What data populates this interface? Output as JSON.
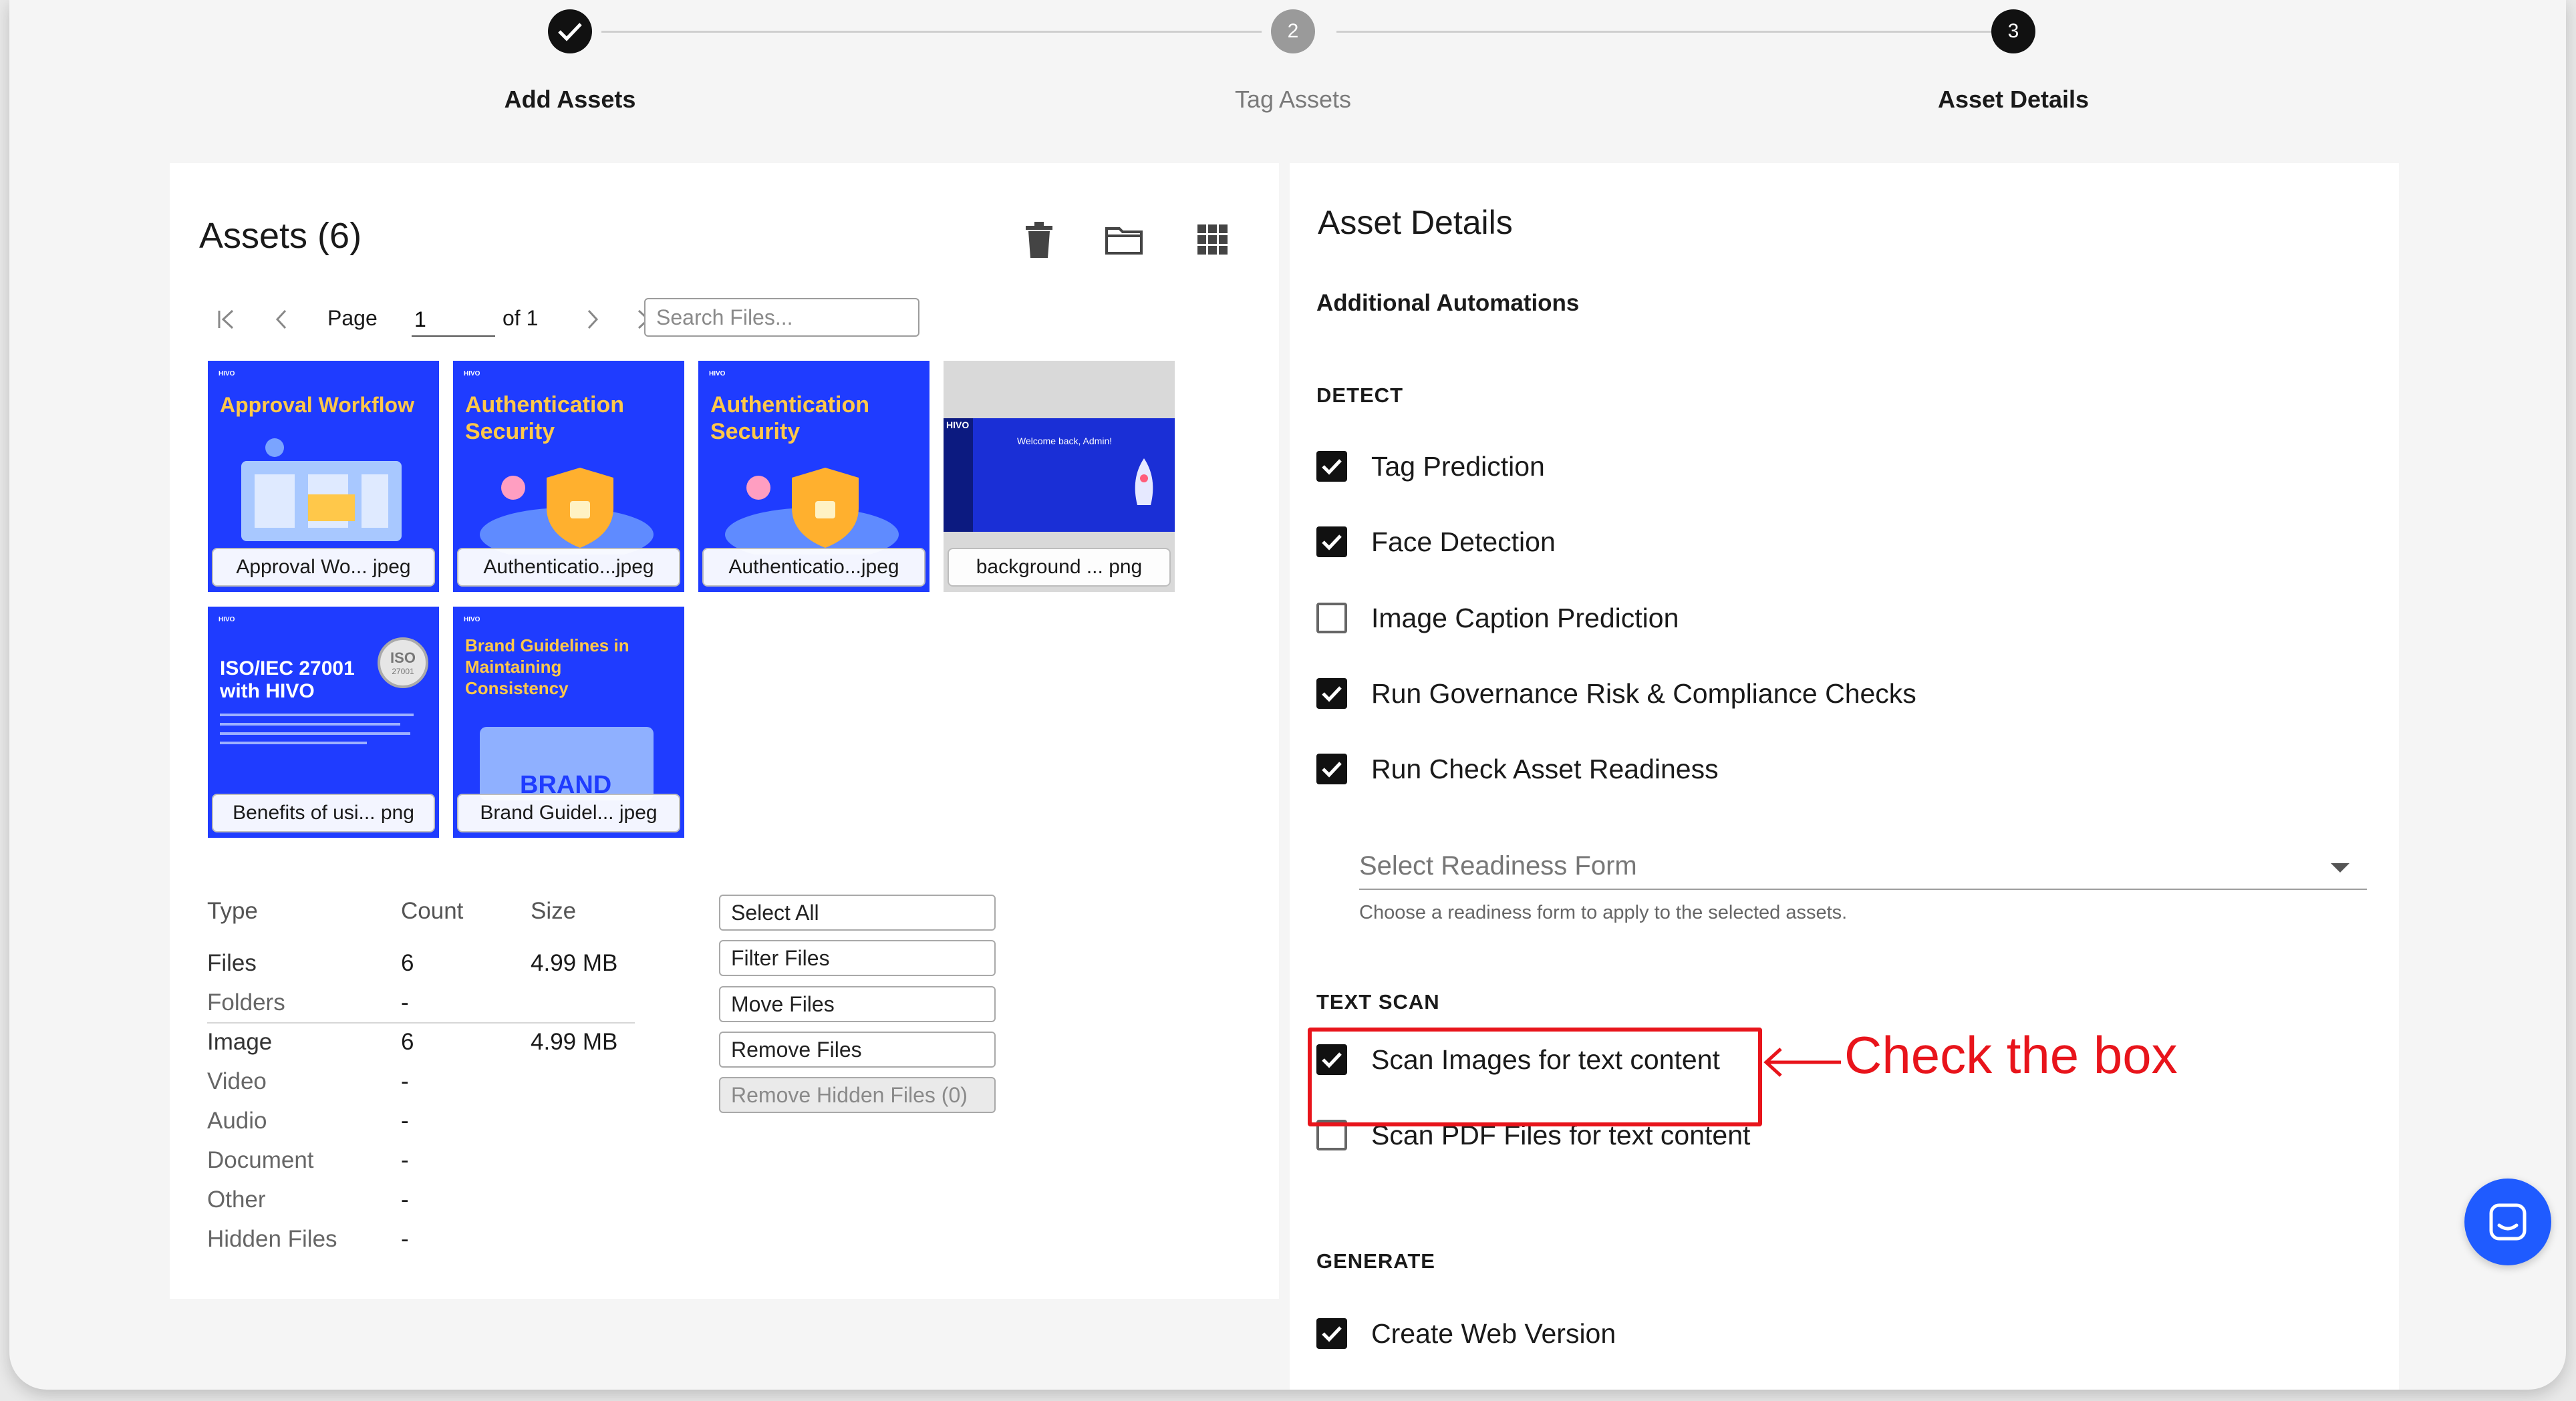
{
  "stepper": {
    "steps": [
      {
        "label": "Add Assets",
        "state": "done",
        "number": ""
      },
      {
        "label": "Tag Assets",
        "state": "pending",
        "number": "2"
      },
      {
        "label": "Asset Details",
        "state": "active",
        "number": "3"
      }
    ]
  },
  "assets": {
    "title": "Assets (6)",
    "pager": {
      "page_label": "Page",
      "page_value": "1",
      "of_label": "of 1"
    },
    "search_placeholder": "Search Files...",
    "thumbnails": [
      {
        "title": "Approval Workflow",
        "caption": "Approval Wo... jpeg",
        "logo": "HIVO"
      },
      {
        "title": "Authentication Security",
        "caption": "Authenticatio...jpeg",
        "logo": "HIVO"
      },
      {
        "title": "Authentication Security",
        "caption": "Authenticatio...jpeg",
        "logo": "HIVO"
      },
      {
        "title": "",
        "caption": "background ...  png",
        "logo": "HIVO",
        "screen_text": "Welcome back, Admin!"
      },
      {
        "title": "ISO/IEC 27001 with HIVO",
        "caption": "Benefits of usi... png",
        "logo": "HIVO",
        "badge": "ISO",
        "badge_sub": "27001"
      },
      {
        "title": "Brand Guidelines in Maintaining Consistency",
        "caption": "Brand Guidel... jpeg",
        "logo": "HIVO",
        "brand": "BRAND"
      }
    ],
    "stats": {
      "headers": [
        "Type",
        "Count",
        "Size"
      ],
      "rows": [
        {
          "type": "Files",
          "count": "6",
          "size": "4.99 MB"
        },
        {
          "type": "Folders",
          "count": "-",
          "size": ""
        },
        {
          "type": "Image",
          "count": "6",
          "size": "4.99 MB"
        },
        {
          "type": "Video",
          "count": "-",
          "size": ""
        },
        {
          "type": "Audio",
          "count": "-",
          "size": ""
        },
        {
          "type": "Document",
          "count": "-",
          "size": ""
        },
        {
          "type": "Other",
          "count": "-",
          "size": ""
        },
        {
          "type": "Hidden Files",
          "count": "-",
          "size": ""
        }
      ]
    },
    "actions": [
      "Select All",
      "Filter Files",
      "Move Files",
      "Remove Files",
      "Remove Hidden Files (0)"
    ]
  },
  "details": {
    "title": "Asset Details",
    "subtitle": "Additional Automations",
    "detect_label": "DETECT",
    "detect": [
      {
        "label": "Tag Prediction",
        "checked": true
      },
      {
        "label": "Face Detection",
        "checked": true
      },
      {
        "label": "Image Caption Prediction",
        "checked": false
      },
      {
        "label": "Run Governance Risk & Compliance Checks",
        "checked": true
      },
      {
        "label": "Run Check Asset Readiness",
        "checked": true
      }
    ],
    "readiness_placeholder": "Select Readiness Form",
    "readiness_helper": "Choose a readiness form to apply to the selected assets.",
    "text_scan_label": "TEXT SCAN",
    "text_scan": [
      {
        "label": "Scan Images for text content",
        "checked": true
      },
      {
        "label": "Scan PDF Files for text content",
        "checked": false
      }
    ],
    "generate_label": "GENERATE",
    "generate": [
      {
        "label": "Create Web Version",
        "checked": true
      }
    ]
  },
  "annotation": {
    "text": "Check the box",
    "color": "#e8141b"
  },
  "colors": {
    "thumb_blue": "#1f3cff",
    "accent_yellow": "#ffc84a",
    "chat_blue": "#1f5bff"
  }
}
